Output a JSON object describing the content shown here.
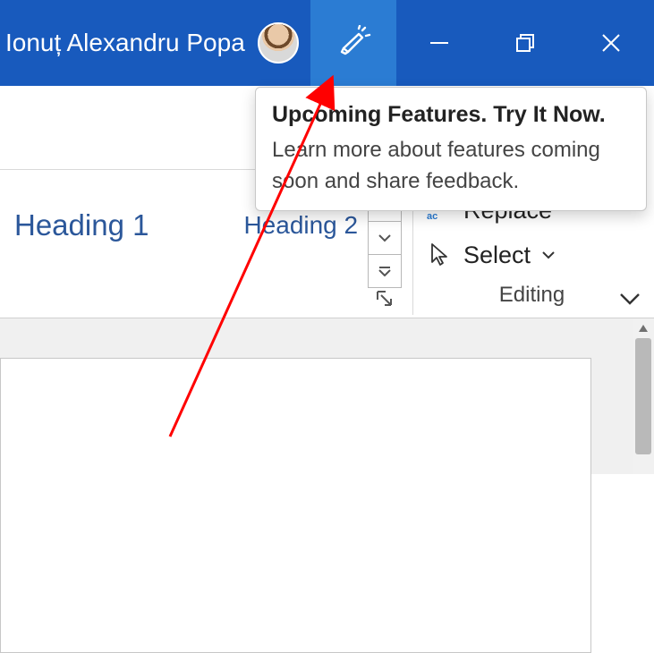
{
  "titlebar": {
    "username": "Ionuț Alexandru Popa"
  },
  "styles": {
    "heading1": "Heading 1",
    "heading2": "Heading 2"
  },
  "editing": {
    "replace": "Replace",
    "select": "Select",
    "group_label": "Editing"
  },
  "callout": {
    "title": "Upcoming Features. Try It Now.",
    "body": "Learn more about features coming soon and share feedback."
  }
}
